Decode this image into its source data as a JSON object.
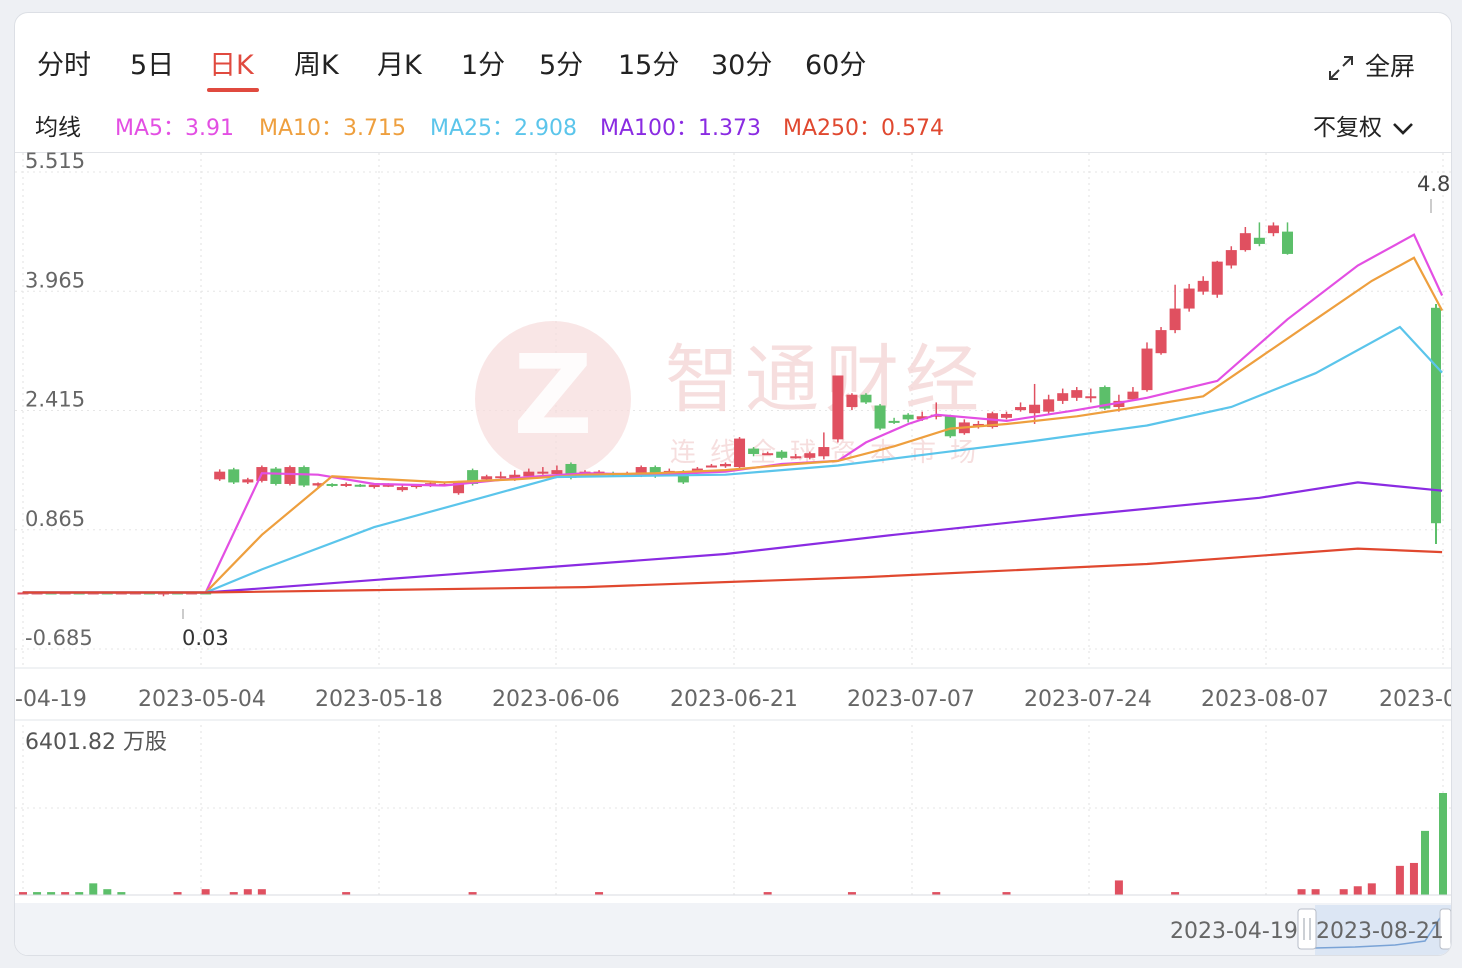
{
  "tabs": [
    {
      "label": "分时",
      "active": false
    },
    {
      "label": "5日",
      "active": false
    },
    {
      "label": "日K",
      "active": true
    },
    {
      "label": "周K",
      "active": false
    },
    {
      "label": "月K",
      "active": false
    },
    {
      "label": "1分",
      "active": false
    },
    {
      "label": "5分",
      "active": false
    },
    {
      "label": "15分",
      "active": false
    },
    {
      "label": "30分",
      "active": false
    },
    {
      "label": "60分",
      "active": false
    }
  ],
  "fullscreen_label": "全屏",
  "ma_header": "均线",
  "ma_legend": [
    {
      "name": "MA5",
      "value": "3.91",
      "color": "#e34fe3"
    },
    {
      "name": "MA10",
      "value": "3.715",
      "color": "#ee9f3e"
    },
    {
      "name": "MA25",
      "value": "2.908",
      "color": "#5bc5eb"
    },
    {
      "name": "MA100",
      "value": "1.373",
      "color": "#8a2be2"
    },
    {
      "name": "MA250",
      "value": "0.574",
      "color": "#e0482f"
    }
  ],
  "ma_separator": "：",
  "restore_label": "不复权",
  "watermark": {
    "name": "智通财经",
    "slogan": "连线全球资本市场",
    "icon_letter": "Z"
  },
  "colors": {
    "up": "#e05060",
    "down": "#5cbf6a",
    "accent": "#e04a3f"
  },
  "chart_data": {
    "type": "candlestick",
    "y_axis_labels": [
      "5.515",
      "3.965",
      "2.415",
      "0.865",
      "-0.685"
    ],
    "ylim": [
      -0.685,
      5.515
    ],
    "x_tick_labels": [
      "-04-19",
      "2023-05-04",
      "2023-05-18",
      "2023-06-06",
      "2023-06-21",
      "2023-07-07",
      "2023-07-24",
      "2023-08-07",
      "2023-0"
    ],
    "max_label": "4.8",
    "min_label": "0.03",
    "candles": [
      [
        0.05,
        0.05,
        0.04,
        0.06
      ],
      [
        0.05,
        0.05,
        0.04,
        0.06
      ],
      [
        0.05,
        0.04,
        0.03,
        0.06
      ],
      [
        0.04,
        0.05,
        0.03,
        0.06
      ],
      [
        0.05,
        0.04,
        0.03,
        0.06
      ],
      [
        0.04,
        0.05,
        0.04,
        0.06
      ],
      [
        0.05,
        0.04,
        0.03,
        0.05
      ],
      [
        0.04,
        0.05,
        0.03,
        0.06
      ],
      [
        0.05,
        0.05,
        0.03,
        0.06
      ],
      [
        0.05,
        0.04,
        0.03,
        0.05
      ],
      [
        0.04,
        0.05,
        0.0,
        0.06
      ],
      [
        0.05,
        0.04,
        0.03,
        0.05
      ],
      [
        0.04,
        0.05,
        0.03,
        0.06
      ],
      [
        0.05,
        0.04,
        0.03,
        0.05
      ],
      [
        1.52,
        1.62,
        1.5,
        1.65
      ],
      [
        1.65,
        1.48,
        1.46,
        1.67
      ],
      [
        1.48,
        1.52,
        1.46,
        1.54
      ],
      [
        1.5,
        1.68,
        1.48,
        1.7
      ],
      [
        1.66,
        1.46,
        1.44,
        1.68
      ],
      [
        1.46,
        1.68,
        1.44,
        1.7
      ],
      [
        1.68,
        1.44,
        1.42,
        1.7
      ],
      [
        1.44,
        1.47,
        1.42,
        1.48
      ],
      [
        1.46,
        1.44,
        1.42,
        1.47
      ],
      [
        1.44,
        1.46,
        1.42,
        1.48
      ],
      [
        1.45,
        1.44,
        1.42,
        1.46
      ],
      [
        1.42,
        1.45,
        1.4,
        1.46
      ],
      [
        1.44,
        1.45,
        1.42,
        1.47
      ],
      [
        1.38,
        1.42,
        1.36,
        1.44
      ],
      [
        1.42,
        1.45,
        1.4,
        1.46
      ],
      [
        1.44,
        1.47,
        1.42,
        1.48
      ],
      [
        1.45,
        1.46,
        1.43,
        1.48
      ],
      [
        1.34,
        1.48,
        1.32,
        1.5
      ],
      [
        1.64,
        1.46,
        1.44,
        1.66
      ],
      [
        1.52,
        1.56,
        1.5,
        1.58
      ],
      [
        1.55,
        1.56,
        1.53,
        1.62
      ],
      [
        1.52,
        1.58,
        1.5,
        1.64
      ],
      [
        1.56,
        1.62,
        1.54,
        1.66
      ],
      [
        1.6,
        1.62,
        1.58,
        1.68
      ],
      [
        1.59,
        1.64,
        1.56,
        1.7
      ],
      [
        1.72,
        1.54,
        1.52,
        1.74
      ],
      [
        1.59,
        1.62,
        1.57,
        1.64
      ],
      [
        1.6,
        1.62,
        1.58,
        1.64
      ],
      [
        1.6,
        1.58,
        1.56,
        1.62
      ],
      [
        1.59,
        1.6,
        1.57,
        1.62
      ],
      [
        1.57,
        1.68,
        1.55,
        1.7
      ],
      [
        1.68,
        1.56,
        1.54,
        1.7
      ],
      [
        1.61,
        1.63,
        1.6,
        1.66
      ],
      [
        1.62,
        1.48,
        1.46,
        1.64
      ],
      [
        1.64,
        1.66,
        1.62,
        1.68
      ],
      [
        1.7,
        1.7,
        1.68,
        1.72
      ],
      [
        1.69,
        1.72,
        1.67,
        1.74
      ],
      [
        1.68,
        2.05,
        1.66,
        2.07
      ],
      [
        1.92,
        1.85,
        1.82,
        1.94
      ],
      [
        1.85,
        1.86,
        1.84,
        1.88
      ],
      [
        1.88,
        1.8,
        1.78,
        1.9
      ],
      [
        1.81,
        1.82,
        1.79,
        1.85
      ],
      [
        1.8,
        1.86,
        1.78,
        1.88
      ],
      [
        1.82,
        1.94,
        1.78,
        2.13
      ],
      [
        2.04,
        2.87,
        2.0,
        2.87
      ],
      [
        2.46,
        2.62,
        2.42,
        2.64
      ],
      [
        2.62,
        2.52,
        2.5,
        2.64
      ],
      [
        2.48,
        2.18,
        2.16,
        2.5
      ],
      [
        2.28,
        2.26,
        2.24,
        2.32
      ],
      [
        2.36,
        2.3,
        2.26,
        2.38
      ],
      [
        2.3,
        2.34,
        2.28,
        2.4
      ],
      [
        2.34,
        2.36,
        2.3,
        2.52
      ],
      [
        2.34,
        2.08,
        2.06,
        2.36
      ],
      [
        2.12,
        2.26,
        2.1,
        2.3
      ],
      [
        2.2,
        2.24,
        2.18,
        2.28
      ],
      [
        2.2,
        2.38,
        2.18,
        2.4
      ],
      [
        2.32,
        2.37,
        2.3,
        2.4
      ],
      [
        2.42,
        2.46,
        2.4,
        2.52
      ],
      [
        2.38,
        2.49,
        2.24,
        2.76
      ],
      [
        2.4,
        2.56,
        2.36,
        2.62
      ],
      [
        2.54,
        2.64,
        2.5,
        2.7
      ],
      [
        2.58,
        2.68,
        2.54,
        2.72
      ],
      [
        2.58,
        2.6,
        2.52,
        2.7
      ],
      [
        2.72,
        2.44,
        2.42,
        2.74
      ],
      [
        2.46,
        2.54,
        2.4,
        2.62
      ],
      [
        2.56,
        2.66,
        2.54,
        2.72
      ],
      [
        2.68,
        3.22,
        2.66,
        3.3
      ],
      [
        3.16,
        3.46,
        3.14,
        3.5
      ],
      [
        3.46,
        3.74,
        3.42,
        4.05
      ],
      [
        3.74,
        4.0,
        3.7,
        4.06
      ],
      [
        3.96,
        4.1,
        3.92,
        4.16
      ],
      [
        3.92,
        4.35,
        3.88,
        4.36
      ],
      [
        4.3,
        4.5,
        4.26,
        4.55
      ],
      [
        4.5,
        4.72,
        4.48,
        4.8
      ],
      [
        4.66,
        4.58,
        4.55,
        4.86
      ],
      [
        4.72,
        4.82,
        4.68,
        4.86
      ],
      [
        4.74,
        4.45,
        4.44,
        4.86
      ]
    ],
    "last_candle": [
      3.75,
      0.95,
      0.68,
      3.8
    ],
    "moving_averages": {
      "MA5": [
        [
          0,
          0.05
        ],
        [
          13,
          0.05
        ],
        [
          17,
          1.6
        ],
        [
          21,
          1.58
        ],
        [
          25,
          1.46
        ],
        [
          30,
          1.44
        ],
        [
          36,
          1.55
        ],
        [
          40,
          1.6
        ],
        [
          45,
          1.58
        ],
        [
          50,
          1.62
        ],
        [
          54,
          1.72
        ],
        [
          58,
          1.76
        ],
        [
          60,
          2.0
        ],
        [
          63,
          2.24
        ],
        [
          65,
          2.36
        ],
        [
          70,
          2.28
        ],
        [
          75,
          2.42
        ],
        [
          80,
          2.58
        ],
        [
          85,
          2.8
        ],
        [
          90,
          3.6
        ],
        [
          95,
          4.3
        ],
        [
          99,
          4.7
        ],
        [
          101,
          3.91
        ]
      ],
      "MA10": [
        [
          0,
          0.05
        ],
        [
          13,
          0.05
        ],
        [
          17,
          0.8
        ],
        [
          22,
          1.56
        ],
        [
          26,
          1.52
        ],
        [
          30,
          1.48
        ],
        [
          35,
          1.52
        ],
        [
          40,
          1.58
        ],
        [
          45,
          1.6
        ],
        [
          50,
          1.64
        ],
        [
          55,
          1.72
        ],
        [
          58,
          1.76
        ],
        [
          62,
          1.95
        ],
        [
          66,
          2.18
        ],
        [
          70,
          2.24
        ],
        [
          75,
          2.34
        ],
        [
          80,
          2.48
        ],
        [
          84,
          2.6
        ],
        [
          88,
          3.1
        ],
        [
          92,
          3.6
        ],
        [
          96,
          4.1
        ],
        [
          99,
          4.4
        ],
        [
          101,
          3.715
        ]
      ],
      "MA25": [
        [
          0,
          0.05
        ],
        [
          13,
          0.05
        ],
        [
          17,
          0.35
        ],
        [
          25,
          0.9
        ],
        [
          33,
          1.3
        ],
        [
          38,
          1.55
        ],
        [
          50,
          1.58
        ],
        [
          58,
          1.7
        ],
        [
          65,
          1.86
        ],
        [
          72,
          2.02
        ],
        [
          80,
          2.22
        ],
        [
          86,
          2.46
        ],
        [
          92,
          2.9
        ],
        [
          98,
          3.5
        ],
        [
          101,
          2.908
        ]
      ],
      "MA100": [
        [
          0,
          0.05
        ],
        [
          13,
          0.05
        ],
        [
          30,
          0.28
        ],
        [
          50,
          0.55
        ],
        [
          62,
          0.8
        ],
        [
          75,
          1.05
        ],
        [
          88,
          1.28
        ],
        [
          95,
          1.48
        ],
        [
          101,
          1.373
        ]
      ],
      "MA250": [
        [
          0,
          0.05
        ],
        [
          13,
          0.05
        ],
        [
          40,
          0.12
        ],
        [
          60,
          0.25
        ],
        [
          80,
          0.42
        ],
        [
          95,
          0.62
        ],
        [
          101,
          0.574
        ]
      ]
    },
    "volume": {
      "label": "6401.82 万股",
      "bars": [
        [
          0,
          1,
          "up"
        ],
        [
          1,
          1,
          "down"
        ],
        [
          2,
          1,
          "down"
        ],
        [
          3,
          1,
          "up"
        ],
        [
          4,
          1,
          "down"
        ],
        [
          5,
          4,
          "down"
        ],
        [
          6,
          2,
          "down"
        ],
        [
          7,
          1,
          "down"
        ],
        [
          11,
          1,
          "up"
        ],
        [
          13,
          2,
          "up"
        ],
        [
          15,
          1,
          "up"
        ],
        [
          16,
          2,
          "up"
        ],
        [
          17,
          2,
          "up"
        ],
        [
          23,
          1,
          "up"
        ],
        [
          32,
          1,
          "up"
        ],
        [
          41,
          1,
          "up"
        ],
        [
          53,
          1,
          "up"
        ],
        [
          59,
          1,
          "up"
        ],
        [
          65,
          1,
          "up"
        ],
        [
          70,
          1,
          "up"
        ],
        [
          78,
          5,
          "up"
        ],
        [
          82,
          1,
          "up"
        ],
        [
          91,
          2,
          "up"
        ],
        [
          92,
          2,
          "up"
        ],
        [
          94,
          2,
          "up"
        ],
        [
          95,
          3,
          "up"
        ],
        [
          96,
          4,
          "up"
        ],
        [
          98,
          10,
          "up"
        ],
        [
          99,
          11,
          "up"
        ],
        [
          100,
          22,
          "down"
        ],
        [
          101,
          35,
          "down"
        ]
      ],
      "max": 35
    },
    "navigator": {
      "start_label": "2023-04-19",
      "end_label": "2023-08-21"
    }
  }
}
